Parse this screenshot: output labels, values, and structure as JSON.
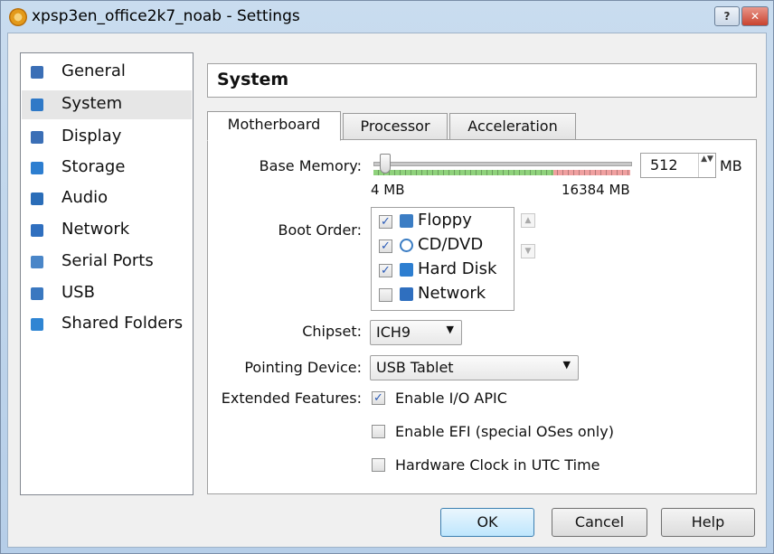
{
  "window": {
    "title": "xpsp3en_office2k7_noab - Settings",
    "help_label": "?",
    "close_label": "✕"
  },
  "sidebar": {
    "items": [
      {
        "label": "General",
        "icon": "general-icon",
        "color": "#3b6fb6"
      },
      {
        "label": "System",
        "icon": "system-icon",
        "color": "#2f79c7"
      },
      {
        "label": "Display",
        "icon": "display-icon",
        "color": "#3b6fb6"
      },
      {
        "label": "Storage",
        "icon": "storage-icon",
        "color": "#2d7ed0"
      },
      {
        "label": "Audio",
        "icon": "audio-icon",
        "color": "#2a6db8"
      },
      {
        "label": "Network",
        "icon": "network-icon",
        "color": "#2f6fbf"
      },
      {
        "label": "Serial Ports",
        "icon": "serial-ports-icon",
        "color": "#4a86c8"
      },
      {
        "label": "USB",
        "icon": "usb-icon",
        "color": "#3a78c0"
      },
      {
        "label": "Shared Folders",
        "icon": "shared-folders-icon",
        "color": "#2f85d3"
      }
    ],
    "selected": "System"
  },
  "page": {
    "title": "System"
  },
  "tabs": [
    {
      "label": "Motherboard",
      "active": true
    },
    {
      "label": "Processor",
      "active": false
    },
    {
      "label": "Acceleration",
      "active": false
    }
  ],
  "motherboard": {
    "base_memory_label": "Base Memory:",
    "memory_min": "4 MB",
    "memory_max": "16384 MB",
    "memory_value": "512",
    "memory_unit": "MB",
    "boot_order_label": "Boot Order:",
    "boot_devices": [
      {
        "label": "Floppy",
        "checked": true,
        "check": "✓",
        "icon": "floppy-icon"
      },
      {
        "label": "CD/DVD",
        "checked": true,
        "check": "✓",
        "icon": "cd-dvd-icon"
      },
      {
        "label": "Hard Disk",
        "checked": true,
        "check": "✓",
        "icon": "hard-disk-icon"
      },
      {
        "label": "Network",
        "checked": false,
        "check": "",
        "icon": "network-icon"
      }
    ],
    "move_up": "▲",
    "move_down": "▼",
    "chipset_label": "Chipset:",
    "chipset_value": "ICH9",
    "pointing_label": "Pointing Device:",
    "pointing_value": "USB Tablet",
    "extended_label": "Extended Features:",
    "features": [
      {
        "label": "Enable I/O APIC",
        "checked": true,
        "check": "✓"
      },
      {
        "label": "Enable EFI (special OSes only)",
        "checked": false,
        "check": ""
      },
      {
        "label": "Hardware Clock in UTC Time",
        "checked": false,
        "check": ""
      }
    ],
    "dropdown_arrow": "▼",
    "spin_arrows": "▲▼"
  },
  "buttons": {
    "ok": "OK",
    "cancel": "Cancel",
    "help": "Help"
  }
}
